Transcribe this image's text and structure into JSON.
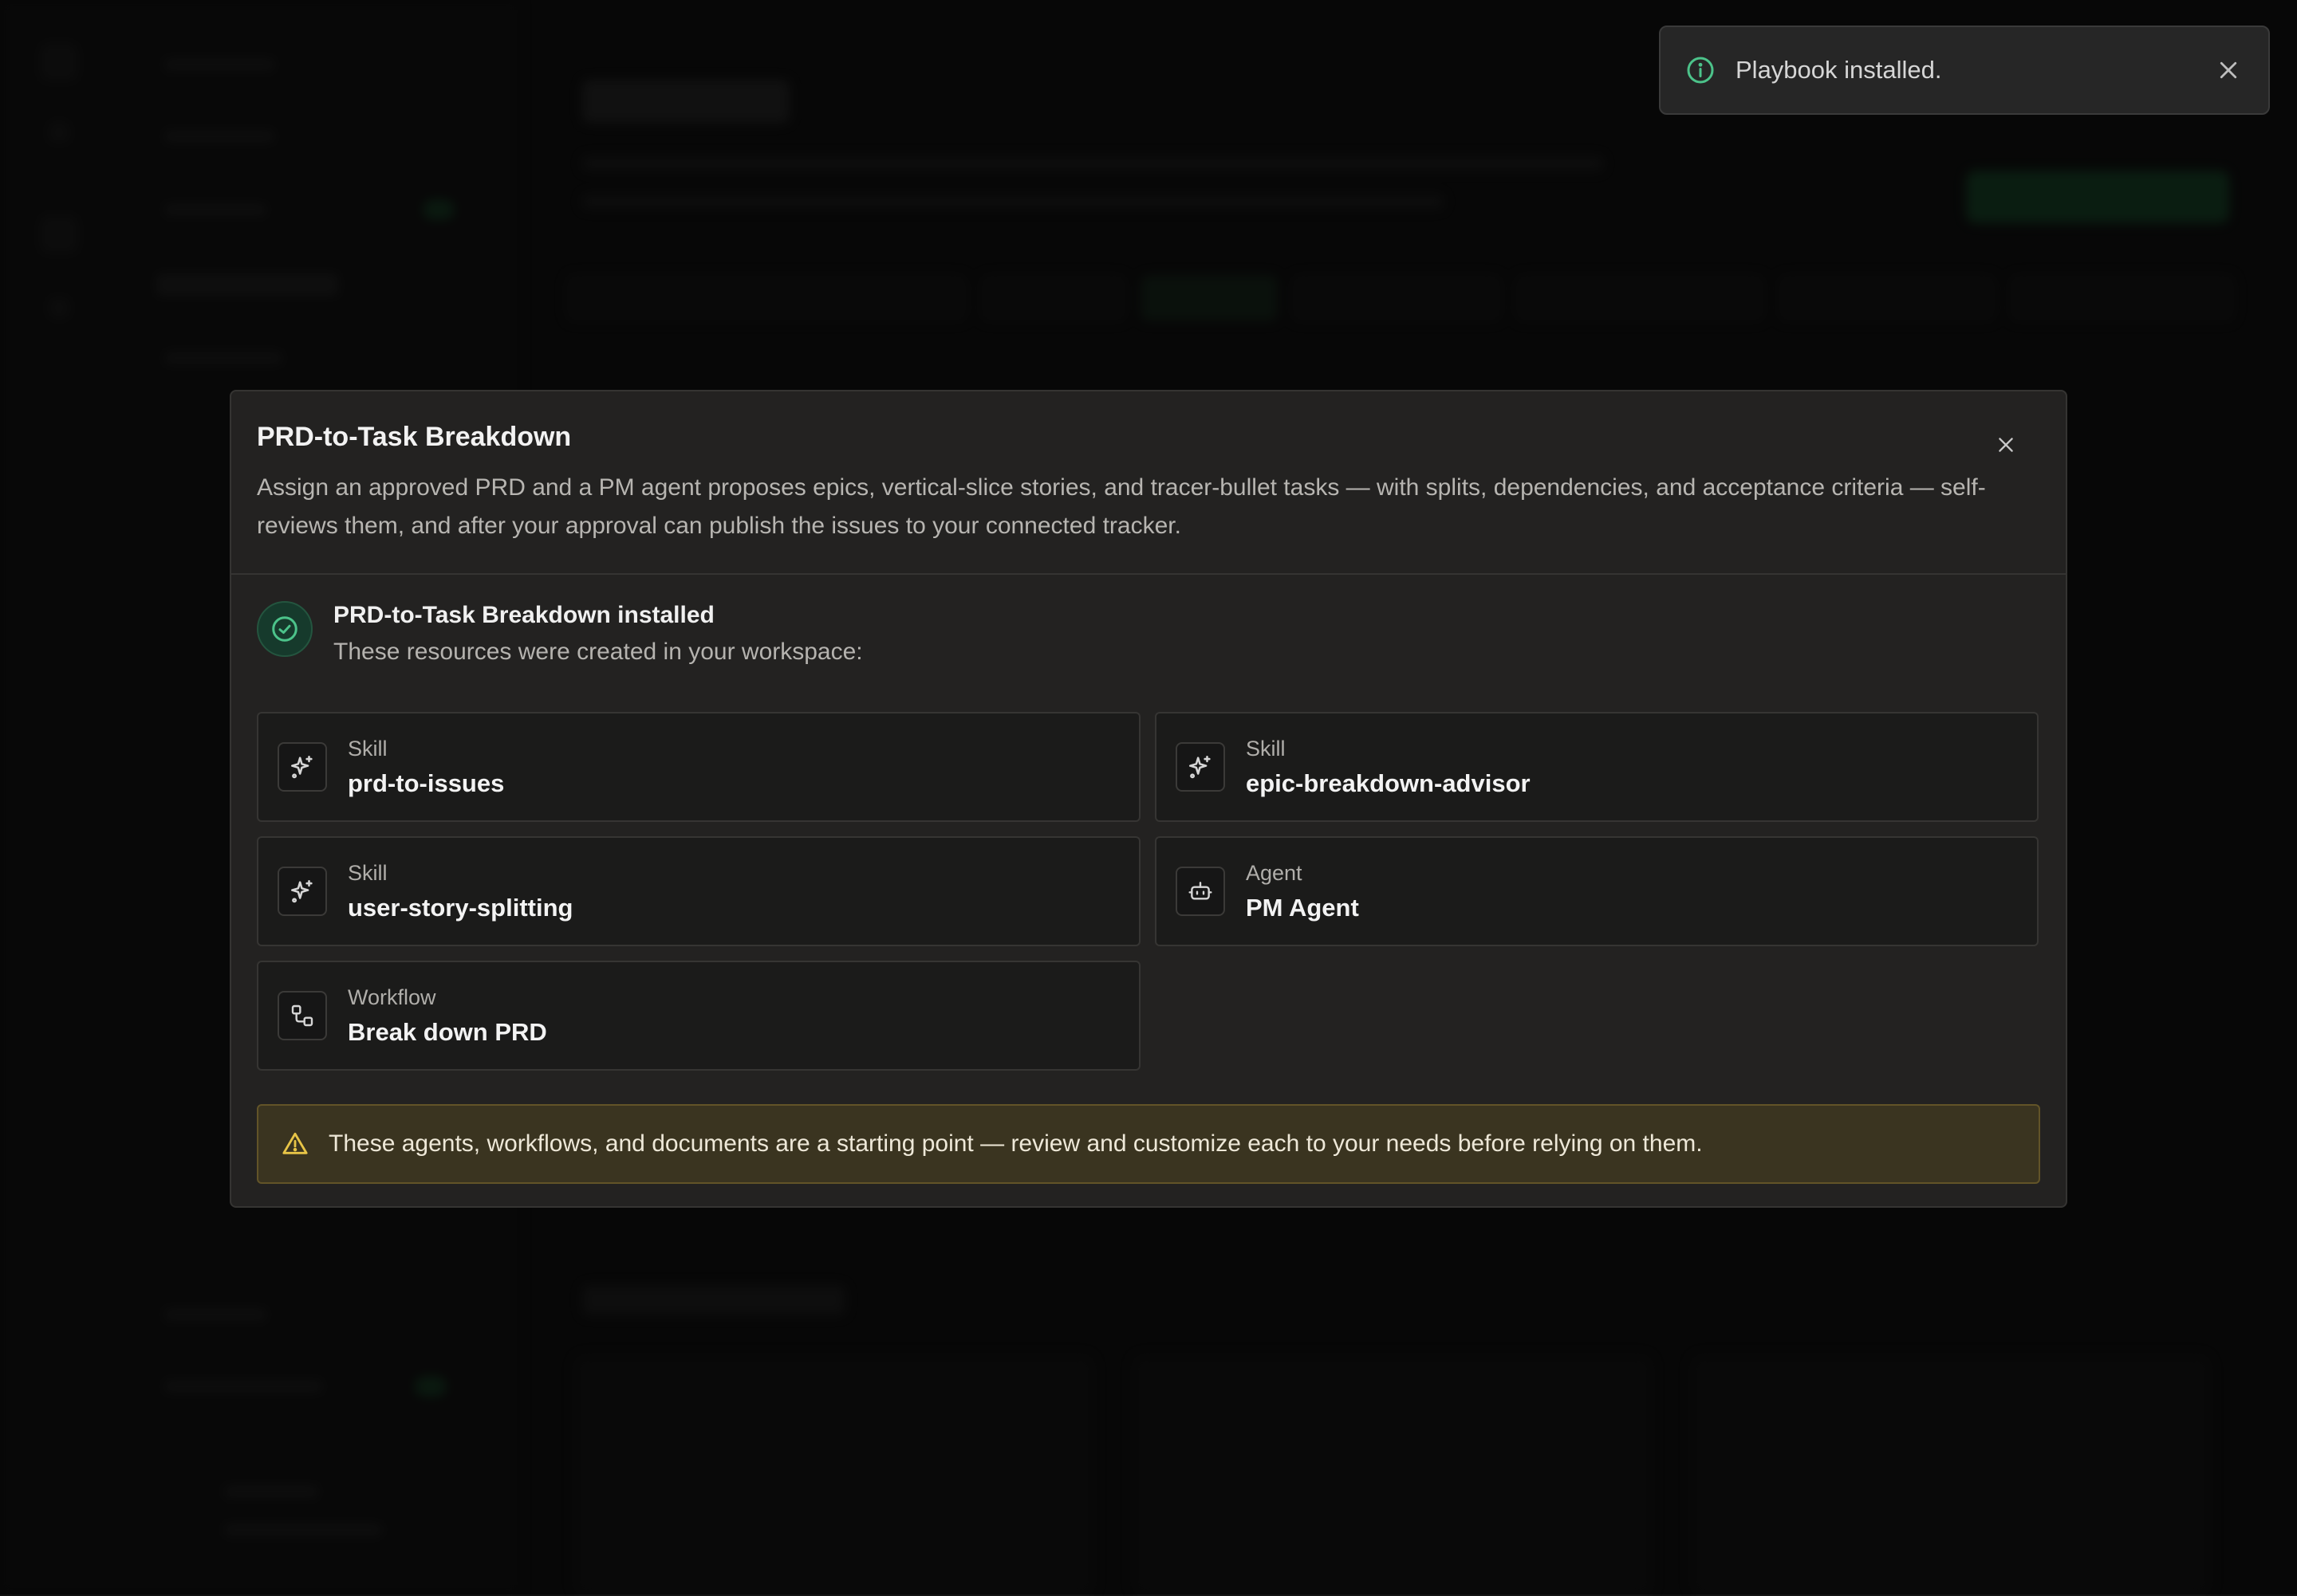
{
  "toast": {
    "message": "Playbook installed."
  },
  "modal": {
    "title": "PRD-to-Task Breakdown",
    "description": "Assign an approved PRD and a PM agent proposes epics, vertical-slice stories, and tracer-bullet tasks — with splits, dependencies, and acceptance criteria — self-reviews them, and after your approval can publish the issues to your connected tracker.",
    "success": {
      "title": "PRD-to-Task Breakdown installed",
      "subtitle": "These resources were created in your workspace:"
    },
    "resources": [
      {
        "type": "Skill",
        "name": "prd-to-issues",
        "icon": "sparkle-icon"
      },
      {
        "type": "Skill",
        "name": "epic-breakdown-advisor",
        "icon": "sparkle-icon"
      },
      {
        "type": "Skill",
        "name": "user-story-splitting",
        "icon": "sparkle-icon"
      },
      {
        "type": "Agent",
        "name": "PM Agent",
        "icon": "bot-icon"
      },
      {
        "type": "Workflow",
        "name": "Break down PRD",
        "icon": "workflow-icon"
      }
    ],
    "warning": "These agents, workflows, and documents are a starting point — review and customize each to your needs before relying on them."
  },
  "colors": {
    "accent_green": "#4cc38a",
    "warning_yellow": "#e8c547",
    "background": "#101010",
    "modal_bg": "#232221"
  }
}
